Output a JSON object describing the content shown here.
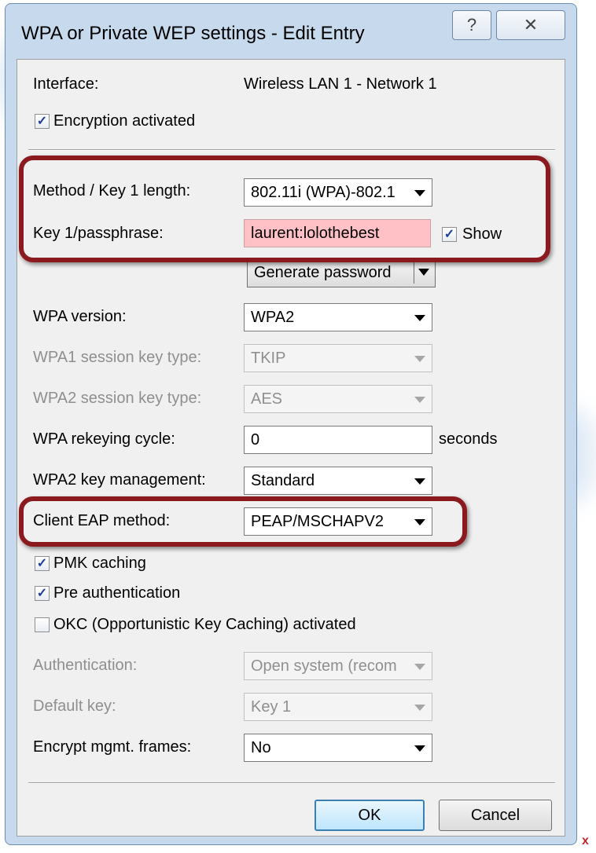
{
  "window": {
    "title": "WPA or Private WEP settings - Edit Entry",
    "help_glyph": "?",
    "close_glyph": "✕"
  },
  "interface": {
    "label": "Interface:",
    "value": "Wireless LAN 1 - Network 1"
  },
  "encryption_activated": {
    "label": "Encryption activated",
    "checked": true
  },
  "method": {
    "label": "Method / Key 1 length:",
    "value": "802.11i (WPA)-802.1"
  },
  "key": {
    "label": "Key 1/passphrase:",
    "value": "laurent:lolothebest",
    "show_label": "Show",
    "show_checked": true
  },
  "generate_password": {
    "label": "Generate password"
  },
  "wpa_version": {
    "label": "WPA version:",
    "value": "WPA2"
  },
  "wpa1_session_key_type": {
    "label": "WPA1 session key type:",
    "value": "TKIP",
    "disabled": true
  },
  "wpa2_session_key_type": {
    "label": "WPA2 session key type:",
    "value": "AES",
    "disabled": true
  },
  "wpa_rekeying_cycle": {
    "label": "WPA rekeying cycle:",
    "value": "0",
    "unit": "seconds"
  },
  "wpa2_key_management": {
    "label": "WPA2 key management:",
    "value": "Standard"
  },
  "client_eap_method": {
    "label": "Client EAP method:",
    "value": "PEAP/MSCHAPV2"
  },
  "pmk_caching": {
    "label": "PMK caching",
    "checked": true
  },
  "pre_authentication": {
    "label": "Pre authentication",
    "checked": true
  },
  "okc": {
    "label": "OKC (Opportunistic Key Caching) activated",
    "checked": false
  },
  "authentication": {
    "label": "Authentication:",
    "value": "Open system (recom",
    "disabled": true
  },
  "default_key": {
    "label": "Default key:",
    "value": "Key 1",
    "disabled": true
  },
  "encrypt_mgmt_frames": {
    "label": "Encrypt mgmt. frames:",
    "value": "No"
  },
  "buttons": {
    "ok": "OK",
    "cancel": "Cancel"
  },
  "checkmark_glyph": "✓",
  "stray_close_glyph": "x",
  "colors": {
    "highlight": "#8b1a1f",
    "key_field_bg": "#ffc0c6",
    "window_frame": "#c7d9ec"
  }
}
